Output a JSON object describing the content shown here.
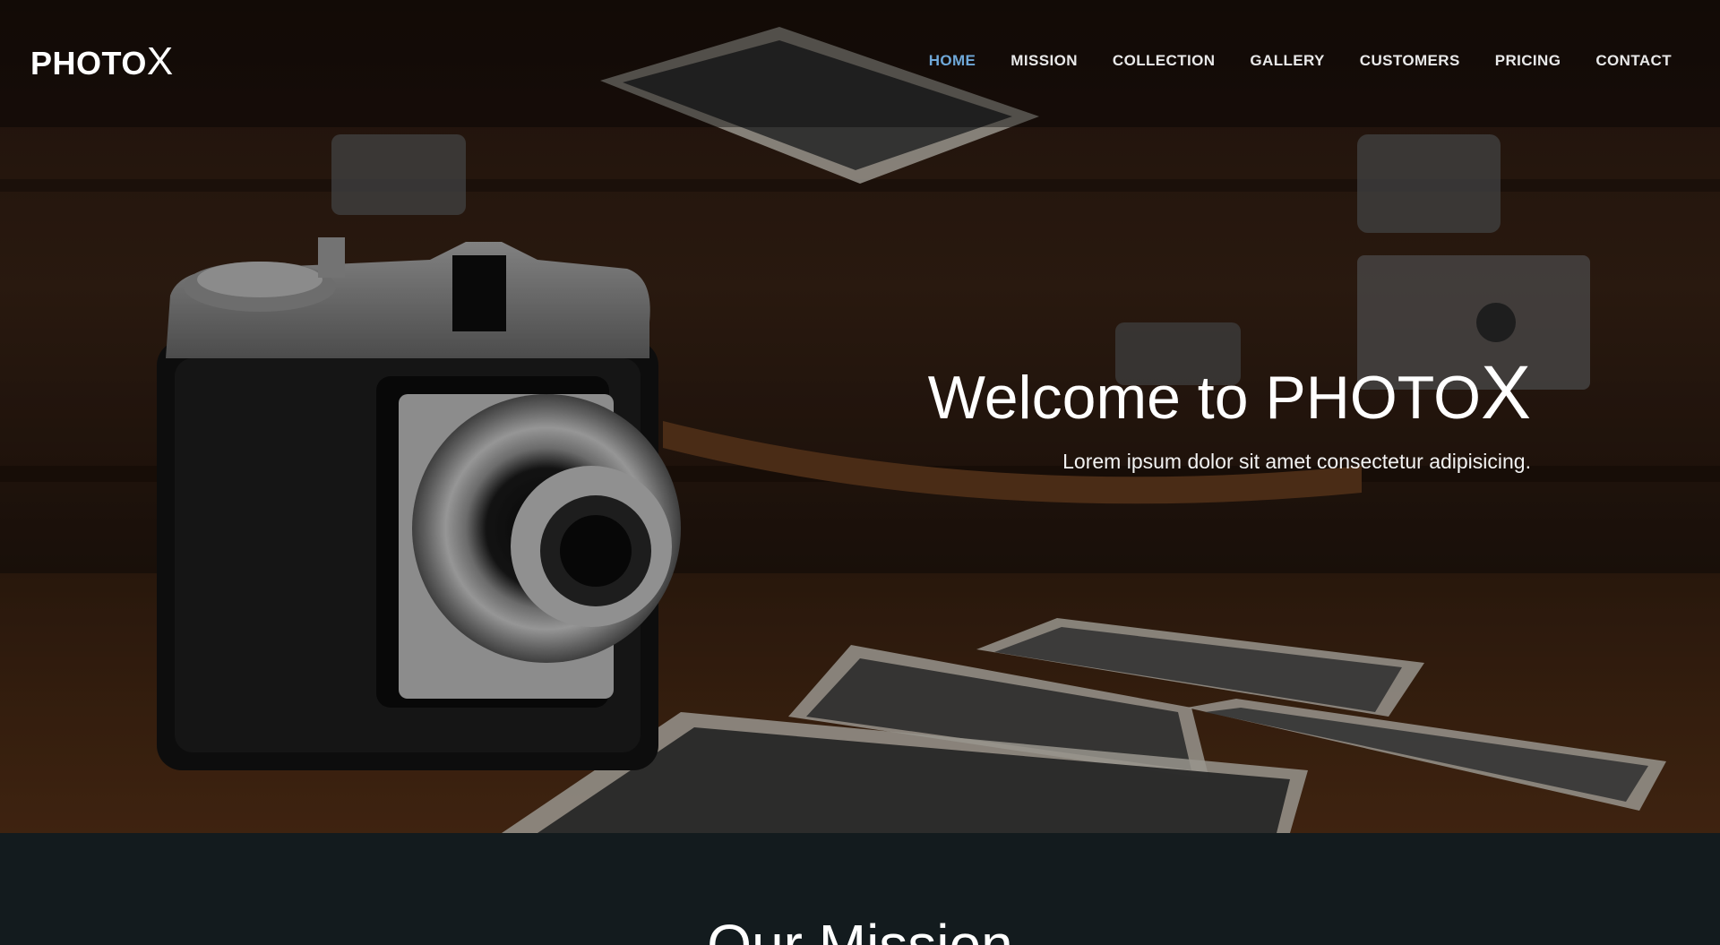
{
  "brand": {
    "text_main": "PHOTO",
    "text_big": "X"
  },
  "nav": {
    "items": [
      {
        "label": "HOME",
        "active": true
      },
      {
        "label": "MISSION",
        "active": false
      },
      {
        "label": "COLLECTION",
        "active": false
      },
      {
        "label": "GALLERY",
        "active": false
      },
      {
        "label": "CUSTOMERS",
        "active": false
      },
      {
        "label": "PRICING",
        "active": false
      },
      {
        "label": "CONTACT",
        "active": false
      }
    ],
    "active_color": "#6fa8d8"
  },
  "hero": {
    "title_main": "Welcome to PHOTO",
    "title_big": "X",
    "subtitle": "Lorem ipsum dolor sit amet consectetur adipisicing."
  },
  "mission": {
    "title": "Our Mission"
  },
  "colors": {
    "section_bg": "#131b1e",
    "hero_wood": "#4a2a16"
  }
}
